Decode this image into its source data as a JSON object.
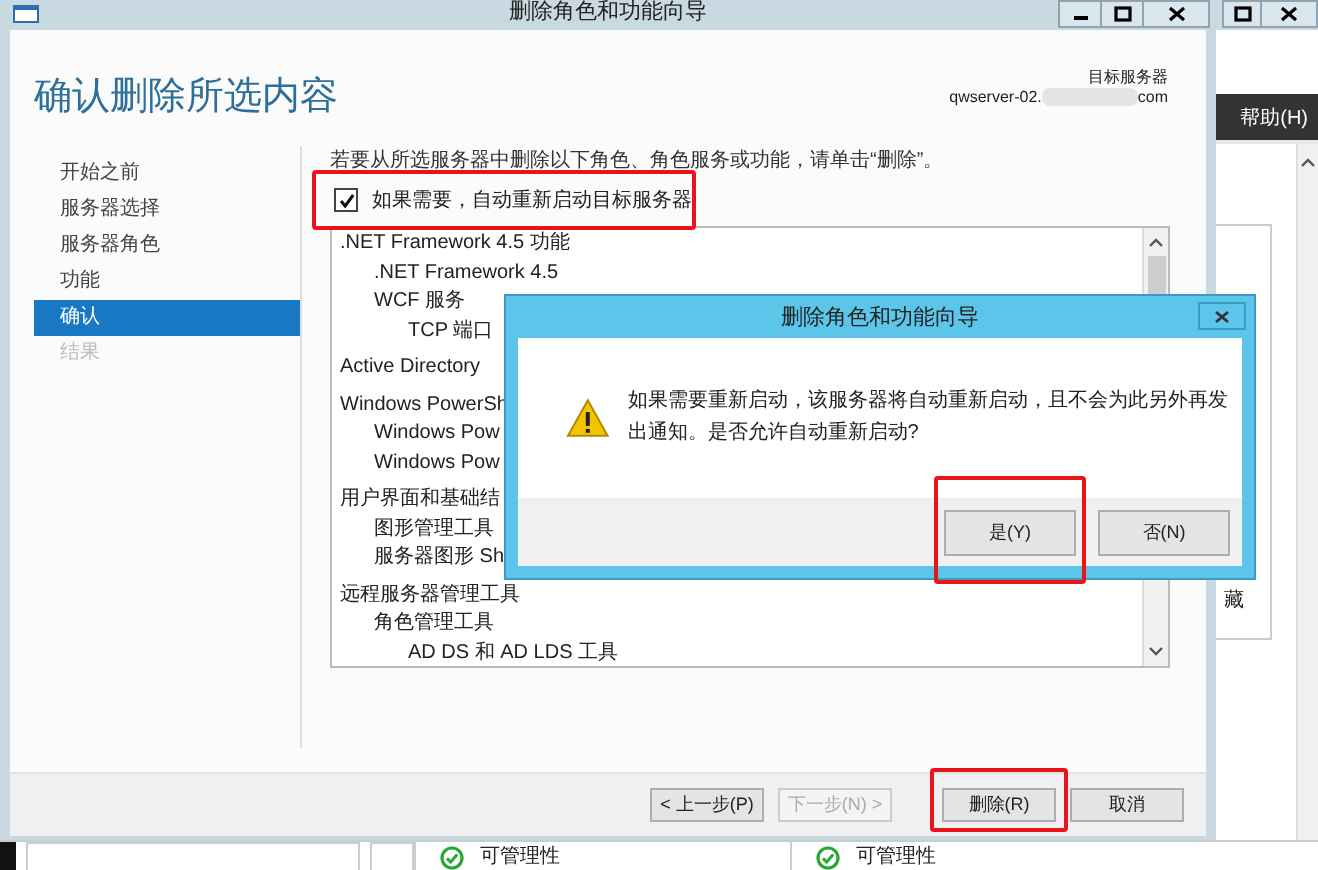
{
  "wizard": {
    "title": "删除角色和功能向导",
    "heading": "确认删除所选内容",
    "target_label": "目标服务器",
    "target_server_start": "qwserver-02.",
    "target_server_end": "com",
    "nav": [
      {
        "label": "开始之前",
        "selected": false,
        "disabled": false
      },
      {
        "label": "服务器选择",
        "selected": false,
        "disabled": false
      },
      {
        "label": "服务器角色",
        "selected": false,
        "disabled": false
      },
      {
        "label": "功能",
        "selected": false,
        "disabled": false
      },
      {
        "label": "确认",
        "selected": true,
        "disabled": false
      },
      {
        "label": "结果",
        "selected": false,
        "disabled": true
      }
    ],
    "instruction": "若要从所选服务器中删除以下角色、角色服务或功能，请单击“删除”。",
    "restart_option": {
      "label": "如果需要，自动重新启动目标服务器",
      "checked": true,
      "highlighted": true
    },
    "features": [
      {
        "label": ".NET Framework 4.5 功能",
        "children": [
          {
            "label": ".NET Framework 4.5"
          },
          {
            "label": "WCF 服务",
            "children": [
              {
                "label": "TCP 端口"
              }
            ]
          }
        ]
      },
      {
        "label": "Active Directory"
      },
      {
        "label": "Windows PowerSh",
        "children": [
          {
            "label": "Windows Pow"
          },
          {
            "label": "Windows Pow"
          }
        ]
      },
      {
        "label": "用户界面和基础结",
        "children": [
          {
            "label": "图形管理工具"
          },
          {
            "label": "服务器图形 Sh"
          }
        ]
      },
      {
        "label": "远程服务器管理工具",
        "children": [
          {
            "label": "角色管理工具",
            "children": [
              {
                "label": "AD DS 和 AD LDS 工具"
              }
            ]
          }
        ]
      }
    ],
    "buttons": [
      {
        "label": "< 上一步(P)",
        "disabled": false,
        "highlighted": false
      },
      {
        "label": "下一步(N) >",
        "disabled": true,
        "highlighted": false
      },
      {
        "label": "删除(R)",
        "disabled": false,
        "highlighted": true
      },
      {
        "label": "取消",
        "disabled": false,
        "highlighted": false
      }
    ]
  },
  "dialog": {
    "title": "删除角色和功能向导",
    "message": "如果需要重新启动，该服务器将自动重新启动，且不会为此另外再发出通知。是否允许自动重新启动?",
    "buttons": [
      {
        "label": "是(Y)",
        "highlighted": true
      },
      {
        "label": "否(N)",
        "highlighted": false
      }
    ]
  },
  "server_manager": {
    "menu_item": "帮助(H)",
    "panel_text": "藏",
    "tiles": [
      {
        "label": "可管理性"
      },
      {
        "label": "可管理性"
      }
    ]
  }
}
